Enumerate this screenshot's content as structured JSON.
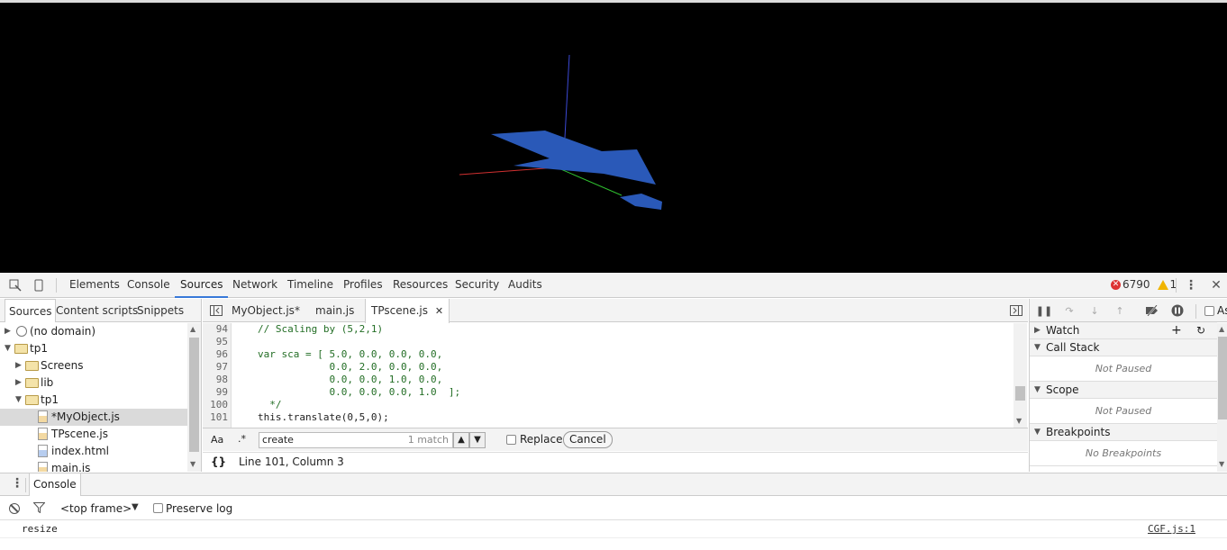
{
  "main_tabs": [
    "Elements",
    "Console",
    "Sources",
    "Network",
    "Timeline",
    "Profiles",
    "Resources",
    "Security",
    "Audits"
  ],
  "active_main_tab": "Sources",
  "counters": {
    "errors": "6790",
    "warnings": "1"
  },
  "navigator": {
    "tabs": [
      "Sources",
      "Content scripts",
      "Snippets"
    ],
    "tree": {
      "no_domain": "(no domain)",
      "tp1": "tp1",
      "screens": "Screens",
      "lib": "lib",
      "tp1_sub": "tp1",
      "files": [
        "*MyObject.js",
        "TPscene.js",
        "index.html",
        "main.js"
      ]
    }
  },
  "editor": {
    "tabs": [
      "MyObject.js*",
      "main.js",
      "TPscene.js"
    ],
    "active_tab": "TPscene.js",
    "lines": [
      {
        "no": "94",
        "text": "// Scaling by (5,2,1)",
        "kind": "comment"
      },
      {
        "no": "95",
        "text": "",
        "kind": "comment"
      },
      {
        "no": "96",
        "text": "var sca = [ 5.0, 0.0, 0.0, 0.0,",
        "kind": "comment"
      },
      {
        "no": "97",
        "text": "            0.0, 2.0, 0.0, 0.0,",
        "kind": "comment"
      },
      {
        "no": "98",
        "text": "            0.0, 0.0, 1.0, 0.0,",
        "kind": "comment"
      },
      {
        "no": "99",
        "text": "            0.0, 0.0, 0.0, 1.0  ];",
        "kind": "comment"
      },
      {
        "no": "100",
        "text": "  */",
        "kind": "comment"
      },
      {
        "no": "101",
        "text": "this.translate(0,5,0);",
        "kind": "code"
      }
    ],
    "search": {
      "case_label": "Aa",
      "regex_label": ".*",
      "query": "create",
      "match_count": "1 match",
      "replace_label": "Replace",
      "cancel_label": "Cancel"
    },
    "status": {
      "braces": "{}",
      "position": "Line 101, Column 3"
    }
  },
  "debugger": {
    "panes": [
      {
        "title": "Watch",
        "body": ""
      },
      {
        "title": "Call Stack",
        "body": "Not Paused"
      },
      {
        "title": "Scope",
        "body": "Not Paused"
      },
      {
        "title": "Breakpoints",
        "body": "No Breakpoints"
      }
    ],
    "async_label": "As"
  },
  "drawer": {
    "tab": "Console",
    "frame": "<top frame>",
    "preserve_log": "Preserve log",
    "messages": [
      {
        "text": "resize",
        "source": "CGF.js:1"
      }
    ]
  },
  "colors": {
    "accent": "#3879d9",
    "plane": "#2a59b8"
  }
}
